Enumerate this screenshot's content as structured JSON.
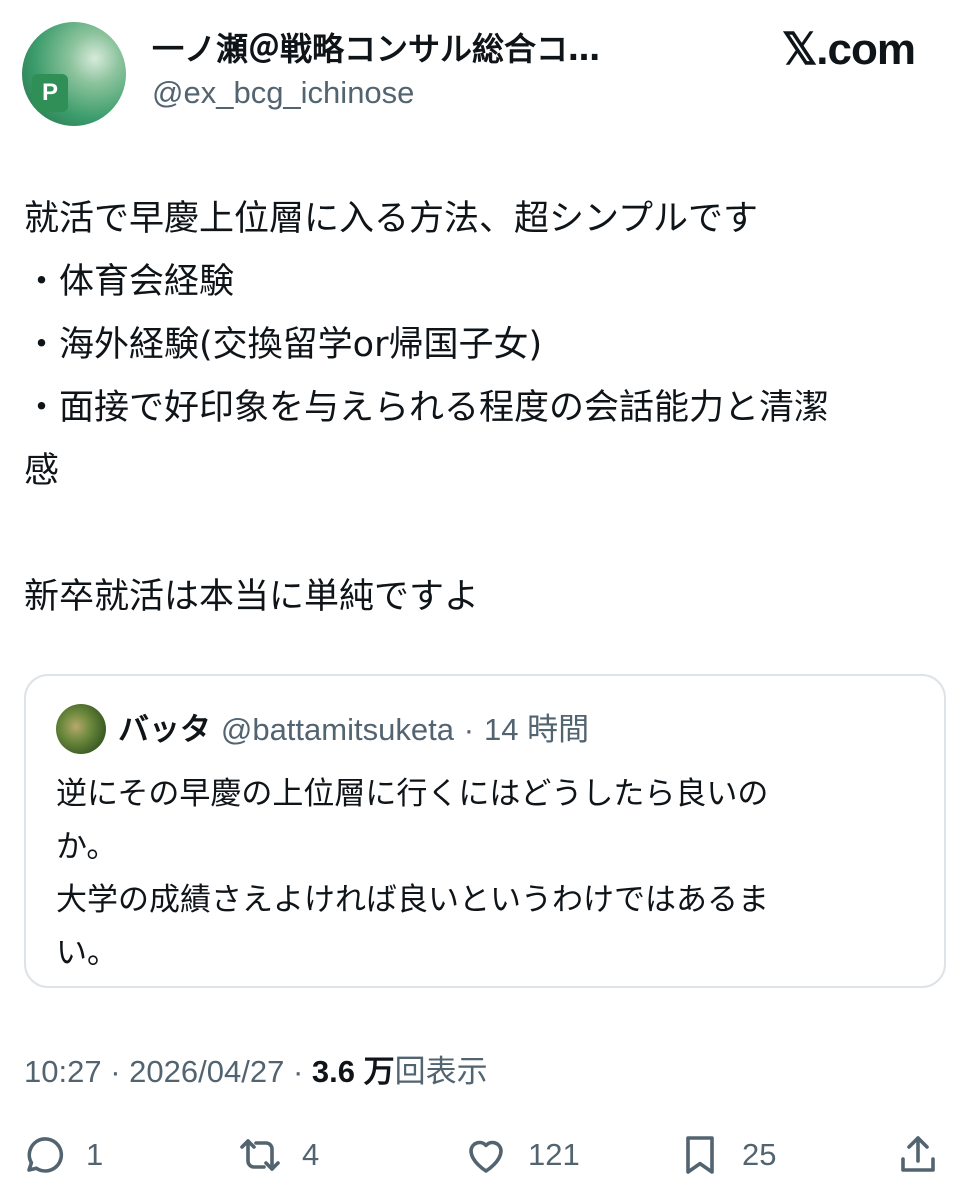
{
  "author": {
    "display_name": "一ノ瀬＠戦略コンサル総合コ…",
    "handle": "@ex_bcg_ichinose",
    "avatar_letter": "P"
  },
  "source_brand": "𝕏.com",
  "tweet": {
    "lines": [
      "就活で早慶上位層に入る方法、超シンプルです",
      "・体育会経験",
      "・海外経験(交換留学or帰国子女)",
      "・面接で好印象を与えられる程度の会話能力と清潔",
      "感",
      "",
      "新卒就活は本当に単純ですよ"
    ]
  },
  "quote": {
    "name": "バッタ",
    "handle": "@battamitsuketa",
    "separator": "·",
    "time": "14 時間",
    "lines": [
      "逆にその早慶の上位層に行くにはどうしたら良いの",
      "か。",
      "大学の成績さえよければ良いというわけではあるま",
      "い。"
    ]
  },
  "meta": {
    "time": "10:27",
    "separator": "·",
    "date": "2026/04/27",
    "views_count": "3.6 万",
    "views_label": "回表示"
  },
  "actions": {
    "reply_count": "1",
    "retweet_count": "4",
    "like_count": "121",
    "bookmark_count": "25"
  },
  "colors": {
    "text_primary": "#0f1419",
    "text_secondary": "#536471",
    "quote_border": "#dde3e7"
  },
  "icons": [
    "reply-icon",
    "retweet-icon",
    "heart-icon",
    "bookmark-icon",
    "share-icon"
  ]
}
